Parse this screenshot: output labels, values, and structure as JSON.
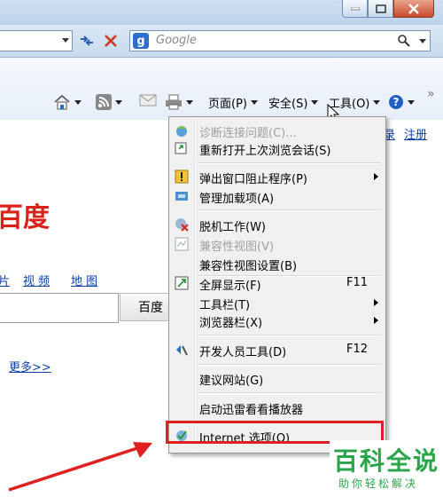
{
  "search": {
    "placeholder": "Google"
  },
  "commandbar": {
    "page_label": "页面(P)",
    "safety_label": "安全(S)",
    "tools_label": "工具(O)",
    "overflow": "»"
  },
  "page": {
    "top_links": [
      "录",
      "注册"
    ],
    "logo_partial": "百度",
    "nav_links": [
      "片",
      "视 频",
      "地 图"
    ],
    "search_button": "百度",
    "more_link": "更多>>"
  },
  "menu": {
    "items": [
      {
        "icon": "diagnose-icon",
        "label": "诊断连接问题(C)...",
        "disabled": true
      },
      {
        "icon": "reopen-session-icon",
        "label": "重新打开上次浏览会话(S)"
      },
      {
        "icon": "popup-blocker-icon",
        "label": "弹出窗口阻止程序(P)",
        "submenu": true
      },
      {
        "icon": "addons-icon",
        "label": "管理加载项(A)"
      },
      {
        "icon": "offline-icon",
        "label": "脱机工作(W)"
      },
      {
        "icon": "compat-view-icon",
        "label": "兼容性视图(V)",
        "disabled": true
      },
      {
        "label": "兼容性视图设置(B)"
      },
      {
        "icon": "fullscreen-icon",
        "label": "全屏显示(F)",
        "shortcut": "F11"
      },
      {
        "label": "工具栏(T)",
        "submenu": true
      },
      {
        "label": "浏览器栏(X)",
        "submenu": true
      },
      {
        "icon": "dev-tools-icon",
        "label": "开发人员工具(D)",
        "shortcut": "F12"
      },
      {
        "label": "建议网站(G)"
      },
      {
        "label": "启动迅雷看看播放器"
      },
      {
        "icon": "internet-options-icon",
        "label": "Internet 选项(O)"
      }
    ]
  },
  "watermark": {
    "title": "百科全说",
    "subtitle": "助你轻松解决"
  },
  "colors": {
    "highlight": "#e02020",
    "arrow": "#e02020",
    "link": "#0b3fa8",
    "baidu_red": "#d9231a",
    "watermark_green": "#2aa54a"
  }
}
